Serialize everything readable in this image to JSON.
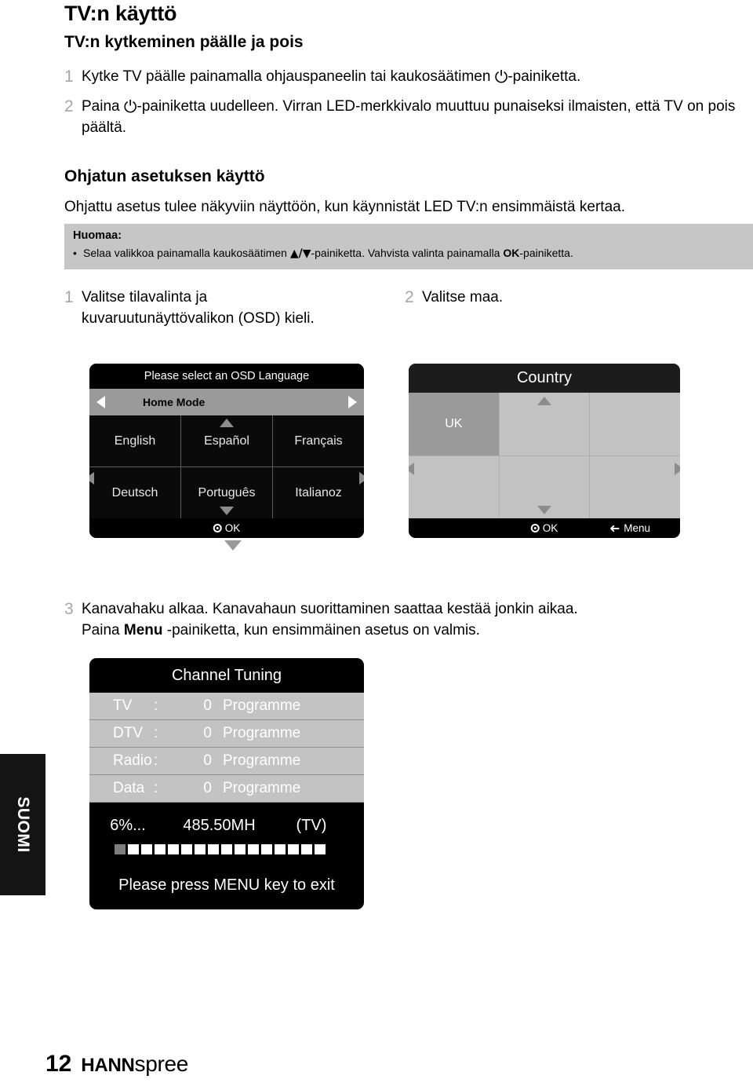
{
  "page": {
    "title": "TV:n käyttö",
    "subtitle": "TV:n kytkeminen päälle ja pois",
    "section2_title": "Ohjatun asetuksen käyttö",
    "section2_intro": "Ohjattu asetus tulee näkyviin näyttöön, kun käynnistät LED TV:n ensimmäistä kertaa."
  },
  "steps_power": [
    {
      "num": "1",
      "before": "Kytke TV päälle painamalla ohjauspaneelin tai kaukosäätimen ",
      "icon": "power-icon",
      "glyph": "⏻",
      "after": "-painiketta."
    },
    {
      "num": "2",
      "before": "Paina ",
      "icon": "power-icon",
      "glyph": "⏻",
      "after": "-painiketta uudelleen. Virran LED-merkkivalo muuttuu punaiseksi ilmaisten, että TV on pois päältä."
    }
  ],
  "note": {
    "title": "Huomaa:",
    "bullet": "•",
    "text_1": "Selaa valikkoa painamalla kaukosäätimen ",
    "arrows": "▲/▼",
    "text_2": "-painiketta. Vahvista valinta painamalla ",
    "bold_ok": "OK",
    "text_3": "-painiketta."
  },
  "wizard_steps": [
    {
      "num": "1",
      "text": "Valitse tilavalinta ja kuvaruutunäyttövalikon (OSD) kieli."
    },
    {
      "num": "2",
      "text": "Valitse maa."
    },
    {
      "num": "3",
      "text_a": "Kanavahaku alkaa. Kanavahaun suorittaminen saattaa kestää jonkin aikaa.",
      "text_b_1": "Paina ",
      "text_b_bold": "Menu",
      "text_b_2": " -painiketta, kun ensimmäinen asetus on valmis."
    }
  ],
  "osd_language": {
    "title": "Please select an OSD Language",
    "mode_label": "Home Mode",
    "left_arrow_icon": "triangle-left-icon",
    "right_arrow_icon": "triangle-right-icon",
    "cells": [
      "English",
      "Español",
      "Français",
      "Deutsch",
      "Português",
      "Italianoz"
    ],
    "ok_label": "OK",
    "ok_icon": "ok-dot-icon",
    "up_icon": "triangle-up-icon",
    "down_icon": "triangle-down-icon",
    "outer_down_icon": "triangle-down-icon"
  },
  "osd_country": {
    "title": "Country",
    "cells": [
      "UK",
      "",
      "",
      "",
      "",
      ""
    ],
    "selected_index": 0,
    "ok_label": "OK",
    "ok_icon": "ok-dot-icon",
    "menu_label": "Menu",
    "menu_icon": "return-arrow-icon"
  },
  "osd_tuning": {
    "title": "Channel Tuning",
    "colon": ":",
    "unit": "Programme",
    "rows": [
      {
        "label": "TV",
        "count": "0"
      },
      {
        "label": "DTV",
        "count": "0"
      },
      {
        "label": "Radio",
        "count": "0"
      },
      {
        "label": "Data",
        "count": "0"
      }
    ],
    "percent": "6%...",
    "frequency": "485.50MH",
    "source": "(TV)",
    "progress_blocks": 16,
    "progress_filled": 1,
    "exit_text": "Please press MENU key to exit"
  },
  "side_tab": {
    "label": "SUOMI"
  },
  "footer": {
    "page_number": "12",
    "brand_bold": "HANN",
    "brand_rest": "spree"
  },
  "colors": {
    "note_bg": "#c6c6c6",
    "step_number": "#a6a6a6",
    "osd_black": "#000000",
    "osd_gray": "#c2c2c2",
    "osd_selected": "#9a9a9a"
  }
}
